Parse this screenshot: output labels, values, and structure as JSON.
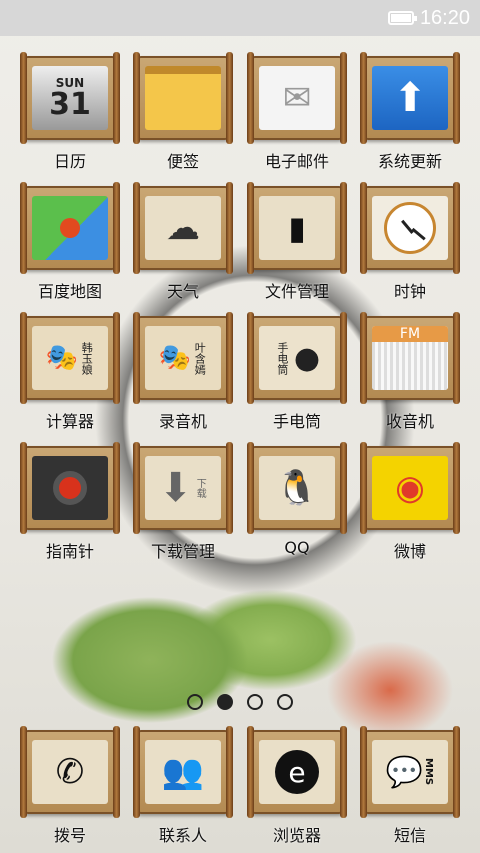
{
  "status_bar": {
    "time": "16:20",
    "battery": "battery-icon"
  },
  "apps": [
    {
      "label": "日历",
      "icon": "calendar-icon",
      "tile_text_1": "SUN",
      "tile_text_2": "31"
    },
    {
      "label": "便签",
      "icon": "sticky-note-icon"
    },
    {
      "label": "电子邮件",
      "icon": "mail-icon"
    },
    {
      "label": "系统更新",
      "icon": "update-arrow-icon"
    },
    {
      "label": "百度地图",
      "icon": "map-icon"
    },
    {
      "label": "天气",
      "icon": "weather-cloud-icon"
    },
    {
      "label": "文件管理",
      "icon": "folder-icon"
    },
    {
      "label": "时钟",
      "icon": "clock-icon"
    },
    {
      "label": "计算器",
      "icon": "calculator-opera-icon",
      "tile_text": "韩玉娘"
    },
    {
      "label": "录音机",
      "icon": "recorder-opera-icon",
      "tile_text": "叶含嫣"
    },
    {
      "label": "手电筒",
      "icon": "flashlight-icon",
      "tile_text": "手电筒"
    },
    {
      "label": "收音机",
      "icon": "radio-icon",
      "tile_text": "FM"
    },
    {
      "label": "指南针",
      "icon": "compass-icon"
    },
    {
      "label": "下载管理",
      "icon": "download-icon",
      "tile_text": "下载"
    },
    {
      "label": "QQ",
      "icon": "qq-penguin-icon"
    },
    {
      "label": "微博",
      "icon": "weibo-icon"
    }
  ],
  "page_indicator": {
    "pages": 4,
    "current": 2
  },
  "dock": [
    {
      "label": "拨号",
      "icon": "phone-icon"
    },
    {
      "label": "联系人",
      "icon": "contacts-icon"
    },
    {
      "label": "浏览器",
      "icon": "browser-icon",
      "tile_text": "e"
    },
    {
      "label": "短信",
      "icon": "sms-icon",
      "tile_text": "MMS"
    }
  ]
}
